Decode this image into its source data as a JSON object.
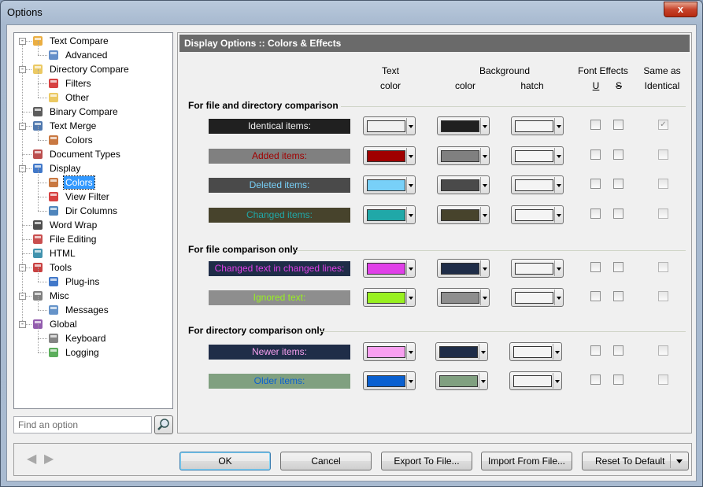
{
  "window": {
    "title": "Options",
    "close_glyph": "x"
  },
  "tree": {
    "items": [
      {
        "label": "Text Compare",
        "icon": "text-compare-icon"
      },
      {
        "label": "Advanced",
        "icon": "advanced-icon"
      },
      {
        "label": "Directory Compare",
        "icon": "folder-compare-icon"
      },
      {
        "label": "Filters",
        "icon": "filter-icon"
      },
      {
        "label": "Other",
        "icon": "folder-icon"
      },
      {
        "label": "Binary Compare",
        "icon": "binary-icon"
      },
      {
        "label": "Text Merge",
        "icon": "merge-icon"
      },
      {
        "label": "Colors",
        "icon": "palette-icon"
      },
      {
        "label": "Document Types",
        "icon": "document-types-icon"
      },
      {
        "label": "Display",
        "icon": "monitor-icon"
      },
      {
        "label": "Colors",
        "icon": "palette-icon"
      },
      {
        "label": "View Filter",
        "icon": "filter-icon"
      },
      {
        "label": "Dir Columns",
        "icon": "columns-icon"
      },
      {
        "label": "Word Wrap",
        "icon": "word-wrap-icon"
      },
      {
        "label": "File Editing",
        "icon": "pencil-icon"
      },
      {
        "label": "HTML",
        "icon": "html-icon"
      },
      {
        "label": "Tools",
        "icon": "tools-icon"
      },
      {
        "label": "Plug-ins",
        "icon": "puzzle-icon"
      },
      {
        "label": "Misc",
        "icon": "misc-icon"
      },
      {
        "label": "Messages",
        "icon": "message-icon"
      },
      {
        "label": "Global",
        "icon": "global-icon"
      },
      {
        "label": "Keyboard",
        "icon": "keyboard-icon"
      },
      {
        "label": "Logging",
        "icon": "log-icon"
      }
    ],
    "selected": "Display > Colors"
  },
  "search": {
    "placeholder": "Find an option",
    "button_icon": "search-icon"
  },
  "panel": {
    "title": "Display Options :: Colors & Effects",
    "headers": {
      "text_1": "Text",
      "text_2": "color",
      "background": "Background",
      "bg_color": "color",
      "bg_hatch": "hatch",
      "font_effects": "Font Effects",
      "underline": "U",
      "strike": "S",
      "same_as_1": "Same as",
      "same_as_2": "Identical"
    },
    "sections": [
      {
        "title": "For file and directory comparison",
        "rows": [
          {
            "label": "Identical items:",
            "label_bg": "#202020",
            "label_fg": "#f0f0f0",
            "text_color": "#f0f0f0",
            "bg_color": "#202020",
            "same_checked": true
          },
          {
            "label": "Added items:",
            "label_bg": "#808080",
            "label_fg": "#a00000",
            "text_color": "#a00000",
            "bg_color": "#808080",
            "same_checked": false
          },
          {
            "label": "Deleted items:",
            "label_bg": "#4a4a4a",
            "label_fg": "#78d0f8",
            "text_color": "#78d0f8",
            "bg_color": "#4a4a4a",
            "same_checked": false
          },
          {
            "label": "Changed items:",
            "label_bg": "#47432c",
            "label_fg": "#20a8a8",
            "text_color": "#20a8a8",
            "bg_color": "#47432c",
            "same_checked": false
          }
        ]
      },
      {
        "title": "For file comparison only",
        "rows": [
          {
            "label": "Changed text in changed lines:",
            "label_bg": "#1f2d48",
            "label_fg": "#e040e8",
            "text_color": "#e040e8",
            "bg_color": "#1f2d48",
            "same_checked": false
          },
          {
            "label": "Ignored text:",
            "label_bg": "#8e8e8e",
            "label_fg": "#98f020",
            "text_color": "#98f020",
            "bg_color": "#8e8e8e",
            "same_checked": false
          }
        ]
      },
      {
        "title": "For directory comparison only",
        "rows": [
          {
            "label": "Newer items:",
            "label_bg": "#1f2d48",
            "label_fg": "#f8a0f0",
            "text_color": "#f8a0f0",
            "bg_color": "#1f2d48",
            "same_checked": false
          },
          {
            "label": "Older items:",
            "label_bg": "#80a080",
            "label_fg": "#0a60d0",
            "text_color": "#0a60d0",
            "bg_color": "#80a080",
            "same_checked": false
          }
        ]
      }
    ]
  },
  "buttons": {
    "back_glyph": "◀",
    "forward_glyph": "▶",
    "ok": "OK",
    "cancel": "Cancel",
    "export": "Export To File...",
    "import": "Import From File...",
    "reset": "Reset To Default"
  }
}
